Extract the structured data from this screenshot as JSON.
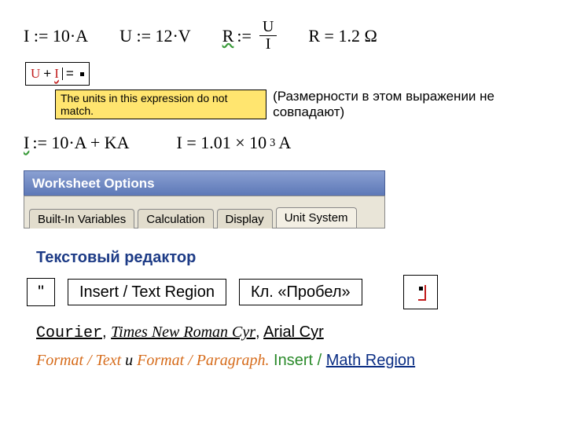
{
  "equations": {
    "i_def": "I := 10·A",
    "u_def": "U := 12·V",
    "r_label": "R",
    "r_assign": ":=",
    "r_num": "U",
    "r_den": "I",
    "r_result": "R = 1.2 Ω"
  },
  "typed": {
    "lhs_u": "U",
    "plus": "+",
    "lhs_i": "I",
    "eq": "="
  },
  "warning": {
    "en": "The units in this expression do not match.",
    "ru": "(Размерности в этом выражении не совпадают)"
  },
  "row2": {
    "i_def2_lhs": "I",
    "i_def2_rhs": ":= 10·A + KA",
    "i_result": "I = 1.01 × 10",
    "i_exp": "3",
    "i_unit": " A"
  },
  "window": {
    "title": "Worksheet Options",
    "tabs": [
      "Built-In Variables",
      "Calculation",
      "Display",
      "Unit System"
    ],
    "active_tab": 3
  },
  "text_editor": {
    "heading": "Текстовый редактор",
    "quote_btn": "\"",
    "insert_btn": "Insert / Text Region",
    "space_btn": "Кл. «Пробел»"
  },
  "fonts": {
    "courier": "Courier",
    "sep1": ", ",
    "times": "Times New Roman Cyr",
    "sep2": ", ",
    "arial": "Arial Cyr"
  },
  "format": {
    "ft": "Format / Text",
    "and": " и ",
    "fp": "Format / Paragraph",
    "dot": ".",
    "insert": "  Insert / ",
    "math": "Math Region"
  }
}
